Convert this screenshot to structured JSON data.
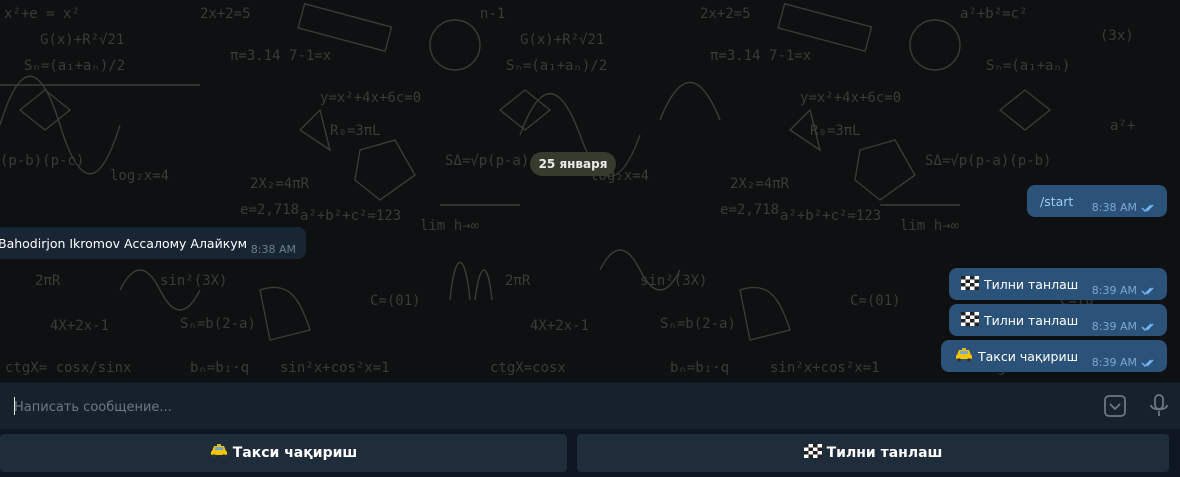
{
  "chat": {
    "date_separator": "25 января",
    "messages": [
      {
        "text": "/start",
        "time": "8:38 AM",
        "direction": "out"
      },
      {
        "text": "Bahodirjon Ikromov  Ассалому Алайкум",
        "time": "8:38 AM",
        "direction": "in"
      },
      {
        "text": "Тилни танлаш",
        "time": "8:39 AM",
        "direction": "out",
        "icon": "chequered-flag-icon"
      },
      {
        "text": "Тилни танлаш",
        "time": "8:39 AM",
        "direction": "out",
        "icon": "chequered-flag-icon"
      },
      {
        "text": "Такси чақириш",
        "time": "8:39 AM",
        "direction": "out",
        "icon": "taxi-icon"
      }
    ]
  },
  "composer": {
    "placeholder": "Написать сообщение...",
    "value": ""
  },
  "reply_keyboard": {
    "buttons": [
      {
        "label": "Такси чақириш",
        "icon": "taxi-icon"
      },
      {
        "label": "Тилни танлаш",
        "icon": "chequered-flag-icon"
      }
    ]
  },
  "colors": {
    "chat_background": "#0e1011",
    "outgoing_bubble": "#2b5278",
    "incoming_bubble": "#182533",
    "panel": "#17212b",
    "read_checks": "#6fb3f2"
  }
}
